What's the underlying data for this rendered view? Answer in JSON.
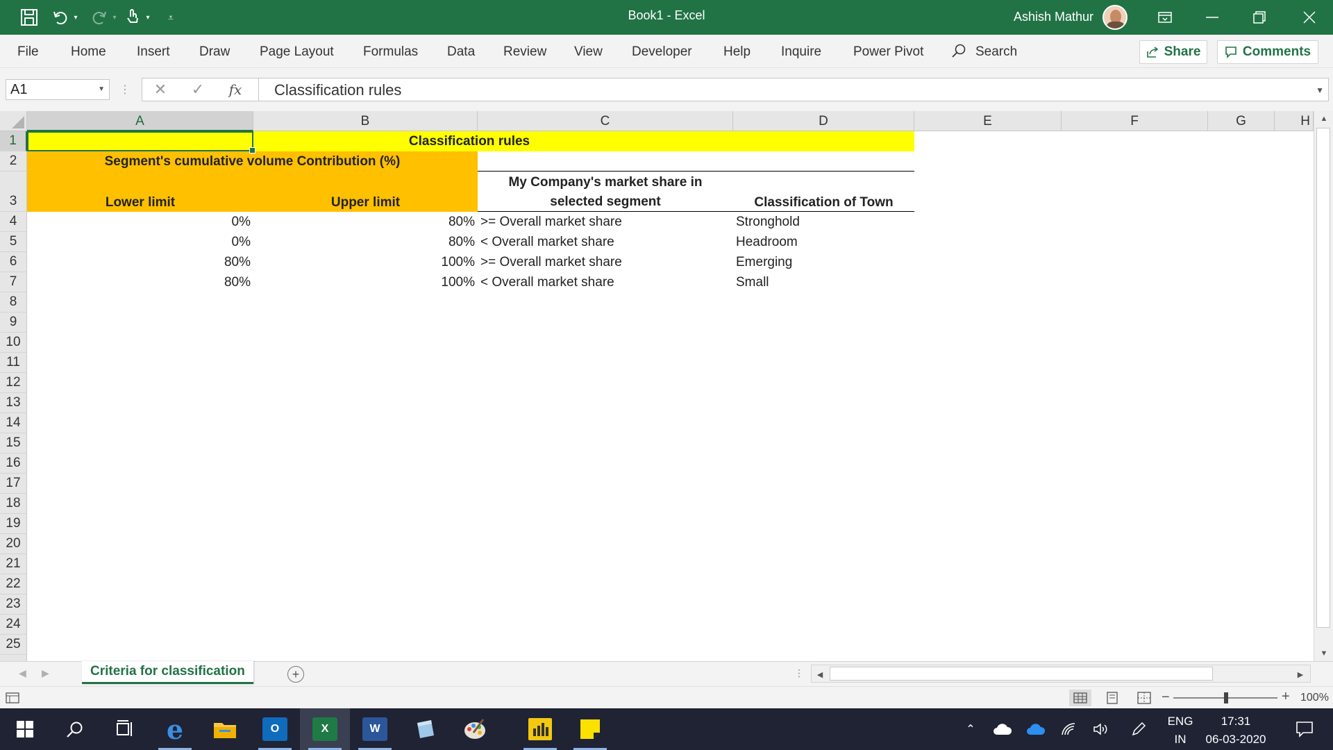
{
  "window": {
    "title": "Book1  -  Excel",
    "user_name": "Ashish Mathur",
    "icons": [
      "save-icon",
      "undo-icon",
      "redo-icon",
      "touch-mode-icon",
      "customize-icon",
      "ribbon-display-icon",
      "minimize-icon",
      "restore-icon",
      "close-icon"
    ]
  },
  "ribbon": {
    "tabs": [
      "File",
      "Home",
      "Insert",
      "Draw",
      "Page Layout",
      "Formulas",
      "Data",
      "Review",
      "View",
      "Developer",
      "Help",
      "Inquire",
      "Power Pivot"
    ],
    "search_label": "Search",
    "share_label": "Share",
    "comments_label": "Comments"
  },
  "formula_bar": {
    "name_box": "A1",
    "fx_label": "fx",
    "content": "Classification rules"
  },
  "grid": {
    "columns": [
      "A",
      "B",
      "C",
      "D",
      "E",
      "F",
      "G",
      "H"
    ],
    "rows": [
      "1",
      "2",
      "3",
      "4",
      "5",
      "6",
      "7",
      "8",
      "9",
      "10",
      "11",
      "12",
      "13",
      "14",
      "15",
      "16",
      "17",
      "18",
      "19",
      "20",
      "21",
      "22",
      "23",
      "24",
      "25"
    ],
    "selected_cell": "A1",
    "colors": {
      "yellow": "#FFFF00",
      "orange": "#FFC000",
      "accent": "#217346"
    },
    "cells": {
      "title": "Classification rules",
      "segment_header": "Segment's cumulative volume Contribution (%)",
      "lower_limit": "Lower limit",
      "upper_limit": "Upper limit",
      "market_share_line1": "My Company's market share in",
      "market_share_line2": "selected segment",
      "classification": "Classification of Town"
    },
    "data_rows": [
      {
        "lower": "0%",
        "upper": "80%",
        "share": ">= Overall market share",
        "class": "Stronghold"
      },
      {
        "lower": "0%",
        "upper": "80%",
        "share": "< Overall market share",
        "class": "Headroom"
      },
      {
        "lower": "80%",
        "upper": "100%",
        "share": ">= Overall market share",
        "class": "Emerging"
      },
      {
        "lower": "80%",
        "upper": "100%",
        "share": "< Overall market share",
        "class": "Small"
      }
    ]
  },
  "sheets": {
    "active": "Criteria for classification"
  },
  "statusbar": {
    "zoom": "100%"
  },
  "taskbar": {
    "apps": [
      "windows-start",
      "search",
      "task-view",
      "edge",
      "file-explorer",
      "outlook",
      "excel",
      "word",
      "notes",
      "paint",
      "power-bi",
      "sticky-notes"
    ],
    "language_line1": "ENG",
    "language_line2": "IN",
    "time": "17:31",
    "date": "06-03-2020"
  }
}
